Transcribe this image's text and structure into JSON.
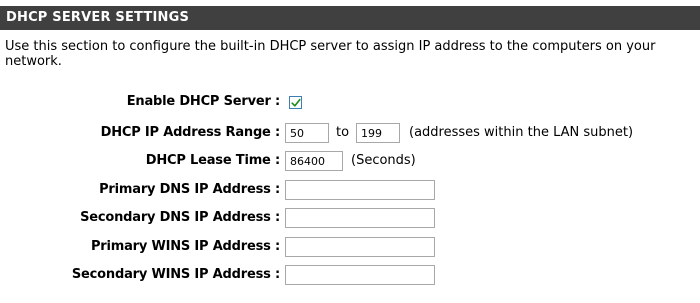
{
  "section": {
    "title": "DHCP SERVER SETTINGS",
    "description": "Use this section to configure the built-in DHCP server to assign IP address to the computers on your network."
  },
  "fields": {
    "enable_dhcp": {
      "label": "Enable DHCP Server :",
      "checked": true
    },
    "ip_range": {
      "label": "DHCP IP Address Range :",
      "start": "50",
      "to_label": "to",
      "end": "199",
      "note": "(addresses within the LAN subnet)"
    },
    "lease_time": {
      "label": "DHCP Lease Time :",
      "value": "86400",
      "unit": "(Seconds)"
    },
    "primary_dns": {
      "label": "Primary DNS IP Address :",
      "value": ""
    },
    "secondary_dns": {
      "label": "Secondary DNS IP Address :",
      "value": ""
    },
    "primary_wins": {
      "label": "Primary WINS IP Address :",
      "value": ""
    },
    "secondary_wins": {
      "label": "Secondary WINS IP Address :",
      "value": ""
    }
  },
  "colors": {
    "header_bg": "#404040",
    "header_text": "#ffffff",
    "checkbox_border": "#3c7fb1",
    "checkmark": "#1d8a1d",
    "input_border": "#a8a8a8"
  },
  "icons": {
    "checkbox_mark": "checkmark-icon"
  }
}
